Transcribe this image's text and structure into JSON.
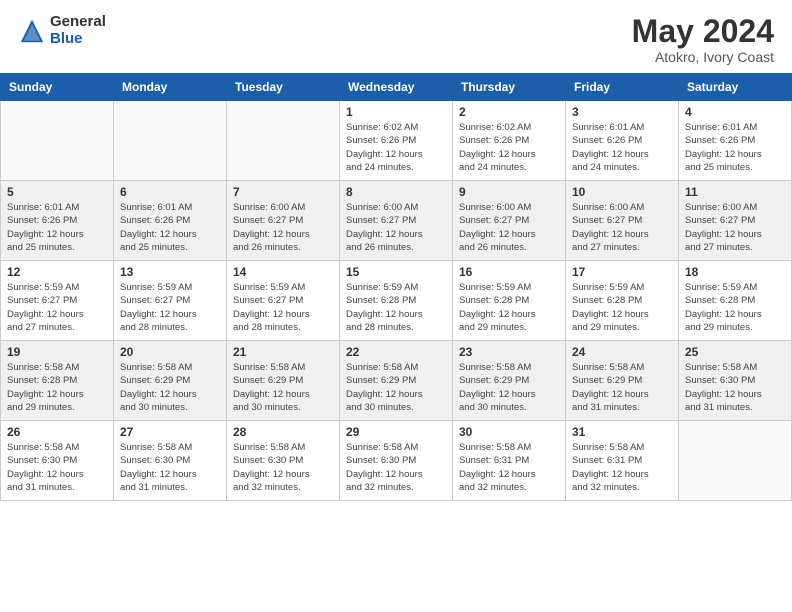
{
  "header": {
    "logo_general": "General",
    "logo_blue": "Blue",
    "month_year": "May 2024",
    "location": "Atokro, Ivory Coast"
  },
  "days_of_week": [
    "Sunday",
    "Monday",
    "Tuesday",
    "Wednesday",
    "Thursday",
    "Friday",
    "Saturday"
  ],
  "weeks": [
    [
      {
        "day": "",
        "info": ""
      },
      {
        "day": "",
        "info": ""
      },
      {
        "day": "",
        "info": ""
      },
      {
        "day": "1",
        "info": "Sunrise: 6:02 AM\nSunset: 6:26 PM\nDaylight: 12 hours\nand 24 minutes."
      },
      {
        "day": "2",
        "info": "Sunrise: 6:02 AM\nSunset: 6:26 PM\nDaylight: 12 hours\nand 24 minutes."
      },
      {
        "day": "3",
        "info": "Sunrise: 6:01 AM\nSunset: 6:26 PM\nDaylight: 12 hours\nand 24 minutes."
      },
      {
        "day": "4",
        "info": "Sunrise: 6:01 AM\nSunset: 6:26 PM\nDaylight: 12 hours\nand 25 minutes."
      }
    ],
    [
      {
        "day": "5",
        "info": "Sunrise: 6:01 AM\nSunset: 6:26 PM\nDaylight: 12 hours\nand 25 minutes."
      },
      {
        "day": "6",
        "info": "Sunrise: 6:01 AM\nSunset: 6:26 PM\nDaylight: 12 hours\nand 25 minutes."
      },
      {
        "day": "7",
        "info": "Sunrise: 6:00 AM\nSunset: 6:27 PM\nDaylight: 12 hours\nand 26 minutes."
      },
      {
        "day": "8",
        "info": "Sunrise: 6:00 AM\nSunset: 6:27 PM\nDaylight: 12 hours\nand 26 minutes."
      },
      {
        "day": "9",
        "info": "Sunrise: 6:00 AM\nSunset: 6:27 PM\nDaylight: 12 hours\nand 26 minutes."
      },
      {
        "day": "10",
        "info": "Sunrise: 6:00 AM\nSunset: 6:27 PM\nDaylight: 12 hours\nand 27 minutes."
      },
      {
        "day": "11",
        "info": "Sunrise: 6:00 AM\nSunset: 6:27 PM\nDaylight: 12 hours\nand 27 minutes."
      }
    ],
    [
      {
        "day": "12",
        "info": "Sunrise: 5:59 AM\nSunset: 6:27 PM\nDaylight: 12 hours\nand 27 minutes."
      },
      {
        "day": "13",
        "info": "Sunrise: 5:59 AM\nSunset: 6:27 PM\nDaylight: 12 hours\nand 28 minutes."
      },
      {
        "day": "14",
        "info": "Sunrise: 5:59 AM\nSunset: 6:27 PM\nDaylight: 12 hours\nand 28 minutes."
      },
      {
        "day": "15",
        "info": "Sunrise: 5:59 AM\nSunset: 6:28 PM\nDaylight: 12 hours\nand 28 minutes."
      },
      {
        "day": "16",
        "info": "Sunrise: 5:59 AM\nSunset: 6:28 PM\nDaylight: 12 hours\nand 29 minutes."
      },
      {
        "day": "17",
        "info": "Sunrise: 5:59 AM\nSunset: 6:28 PM\nDaylight: 12 hours\nand 29 minutes."
      },
      {
        "day": "18",
        "info": "Sunrise: 5:59 AM\nSunset: 6:28 PM\nDaylight: 12 hours\nand 29 minutes."
      }
    ],
    [
      {
        "day": "19",
        "info": "Sunrise: 5:58 AM\nSunset: 6:28 PM\nDaylight: 12 hours\nand 29 minutes."
      },
      {
        "day": "20",
        "info": "Sunrise: 5:58 AM\nSunset: 6:29 PM\nDaylight: 12 hours\nand 30 minutes."
      },
      {
        "day": "21",
        "info": "Sunrise: 5:58 AM\nSunset: 6:29 PM\nDaylight: 12 hours\nand 30 minutes."
      },
      {
        "day": "22",
        "info": "Sunrise: 5:58 AM\nSunset: 6:29 PM\nDaylight: 12 hours\nand 30 minutes."
      },
      {
        "day": "23",
        "info": "Sunrise: 5:58 AM\nSunset: 6:29 PM\nDaylight: 12 hours\nand 30 minutes."
      },
      {
        "day": "24",
        "info": "Sunrise: 5:58 AM\nSunset: 6:29 PM\nDaylight: 12 hours\nand 31 minutes."
      },
      {
        "day": "25",
        "info": "Sunrise: 5:58 AM\nSunset: 6:30 PM\nDaylight: 12 hours\nand 31 minutes."
      }
    ],
    [
      {
        "day": "26",
        "info": "Sunrise: 5:58 AM\nSunset: 6:30 PM\nDaylight: 12 hours\nand 31 minutes."
      },
      {
        "day": "27",
        "info": "Sunrise: 5:58 AM\nSunset: 6:30 PM\nDaylight: 12 hours\nand 31 minutes."
      },
      {
        "day": "28",
        "info": "Sunrise: 5:58 AM\nSunset: 6:30 PM\nDaylight: 12 hours\nand 32 minutes."
      },
      {
        "day": "29",
        "info": "Sunrise: 5:58 AM\nSunset: 6:30 PM\nDaylight: 12 hours\nand 32 minutes."
      },
      {
        "day": "30",
        "info": "Sunrise: 5:58 AM\nSunset: 6:31 PM\nDaylight: 12 hours\nand 32 minutes."
      },
      {
        "day": "31",
        "info": "Sunrise: 5:58 AM\nSunset: 6:31 PM\nDaylight: 12 hours\nand 32 minutes."
      },
      {
        "day": "",
        "info": ""
      }
    ]
  ]
}
